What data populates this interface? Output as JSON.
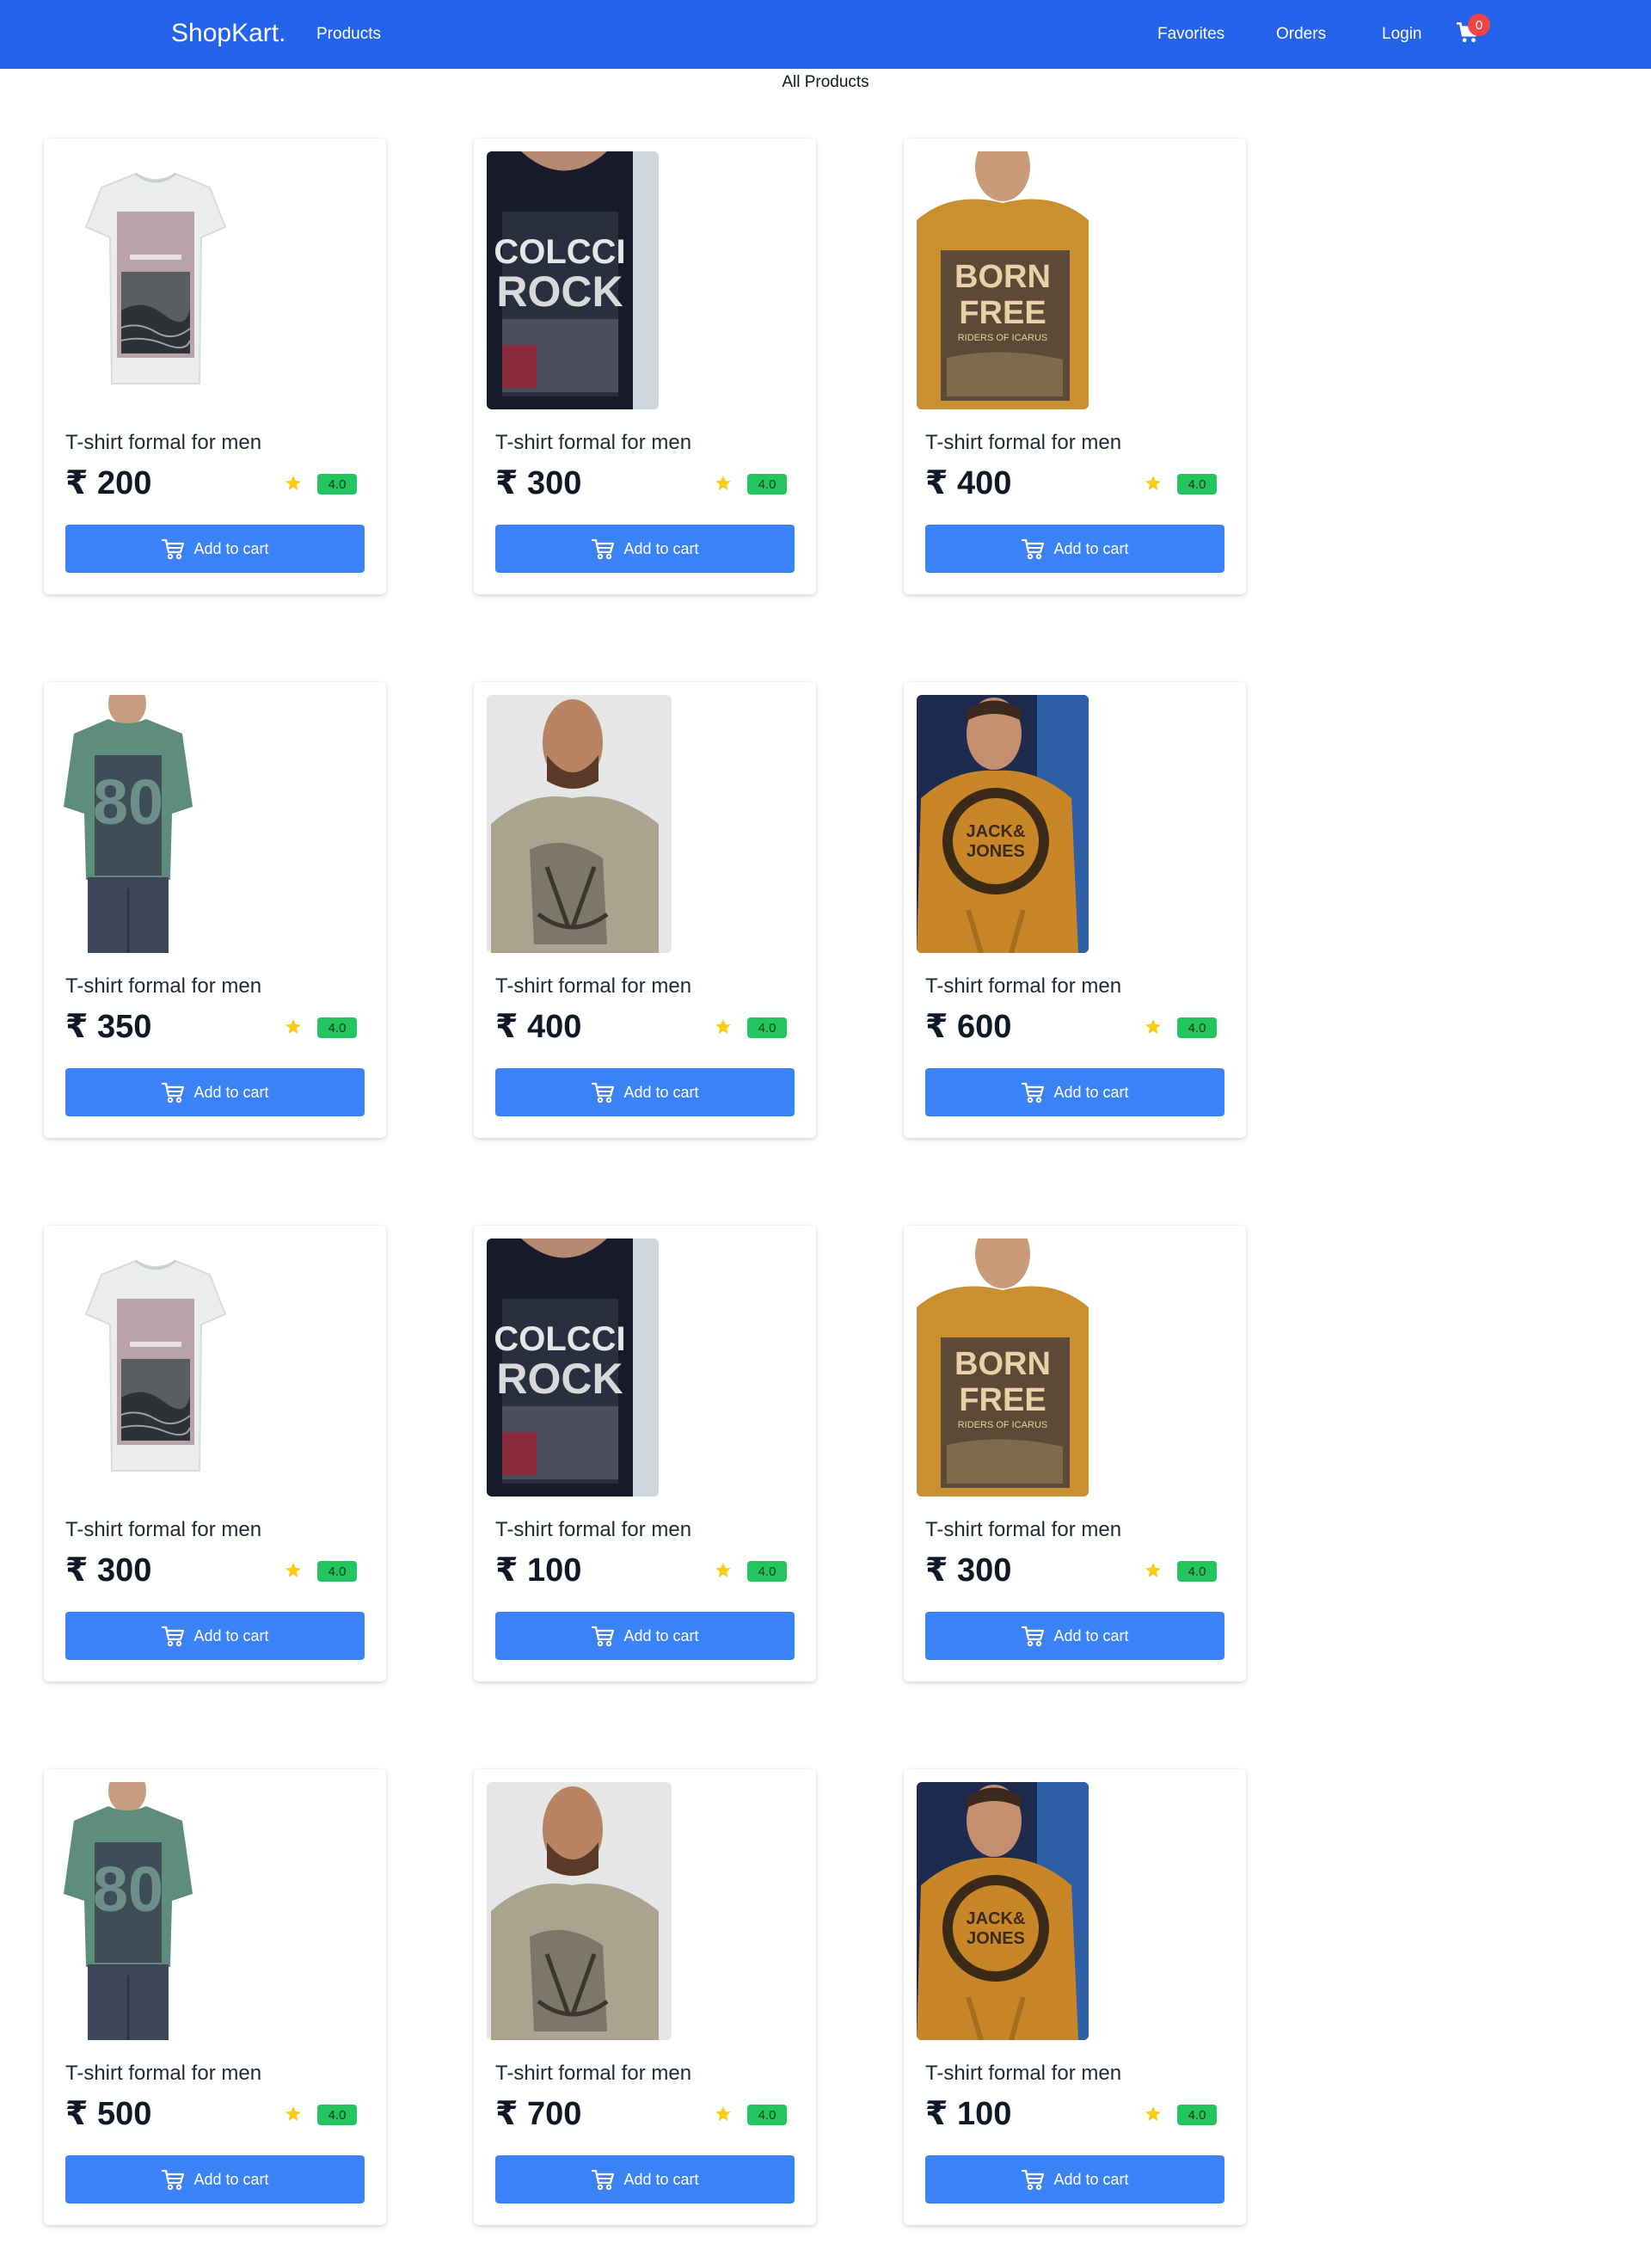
{
  "navbar": {
    "brand": "ShopKart.",
    "products_label": "Products",
    "favorites_label": "Favorites",
    "orders_label": "Orders",
    "login_label": "Login",
    "cart_count": "0"
  },
  "page": {
    "heading": "All Products"
  },
  "colors": {
    "navbar": "#2563eb",
    "button": "#3b82f6",
    "rating_badge": "#22c55e",
    "star": "#facc15",
    "cart_badge": "#ef4444"
  },
  "products": [
    {
      "title": "T-shirt formal for men",
      "price": "₹ 200",
      "rating": "4.0",
      "button_label": "Add to cart",
      "image": "white-tshirt"
    },
    {
      "title": "T-shirt formal for men",
      "price": "₹ 300",
      "rating": "4.0",
      "button_label": "Add to cart",
      "image": "navy-colcci-rock-tshirt"
    },
    {
      "title": "T-shirt formal for men",
      "price": "₹ 400",
      "rating": "4.0",
      "button_label": "Add to cart",
      "image": "mustard-born-free-tshirt"
    },
    {
      "title": "T-shirt formal for men",
      "price": "₹ 350",
      "rating": "4.0",
      "button_label": "Add to cart",
      "image": "teal-graphic-tshirt"
    },
    {
      "title": "T-shirt formal for men",
      "price": "₹ 400",
      "rating": "4.0",
      "button_label": "Add to cart",
      "image": "olive-anchor-tshirt"
    },
    {
      "title": "T-shirt formal for men",
      "price": "₹ 600",
      "rating": "4.0",
      "button_label": "Add to cart",
      "image": "mustard-jack-jones-hoodie"
    },
    {
      "title": "T-shirt formal for men",
      "price": "₹ 300",
      "rating": "4.0",
      "button_label": "Add to cart",
      "image": "white-tshirt"
    },
    {
      "title": "T-shirt formal for men",
      "price": "₹ 100",
      "rating": "4.0",
      "button_label": "Add to cart",
      "image": "navy-colcci-rock-tshirt"
    },
    {
      "title": "T-shirt formal for men",
      "price": "₹ 300",
      "rating": "4.0",
      "button_label": "Add to cart",
      "image": "mustard-born-free-tshirt"
    },
    {
      "title": "T-shirt formal for men",
      "price": "₹ 500",
      "rating": "4.0",
      "button_label": "Add to cart",
      "image": "teal-graphic-tshirt"
    },
    {
      "title": "T-shirt formal for men",
      "price": "₹ 700",
      "rating": "4.0",
      "button_label": "Add to cart",
      "image": "olive-anchor-tshirt"
    },
    {
      "title": "T-shirt formal for men",
      "price": "₹ 100",
      "rating": "4.0",
      "button_label": "Add to cart",
      "image": "mustard-jack-jones-hoodie"
    }
  ]
}
